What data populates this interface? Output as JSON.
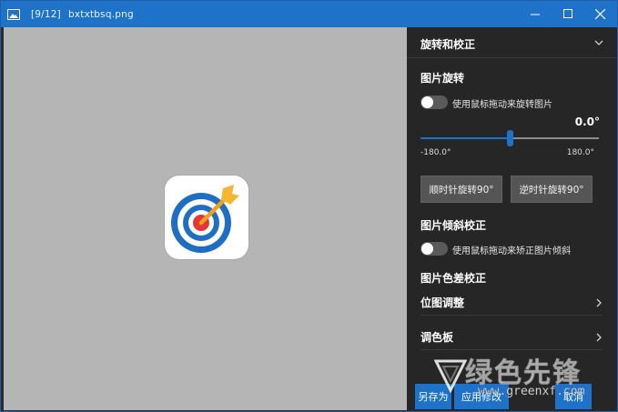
{
  "window": {
    "counter": "[9/12]",
    "filename": "bxtxtbsq.png"
  },
  "panel": {
    "header": "旋转和校正",
    "rotate": {
      "title": "图片旋转",
      "toggle_label": "使用鼠标拖动来旋转图片",
      "angle": "0.0°",
      "angle_value": 0.0,
      "min_label": "-180.0°",
      "max_label": "180.0°",
      "cw_button": "顺时针旋转90°",
      "ccw_button": "逆时针旋转90°"
    },
    "skew": {
      "title": "图片倾斜校正",
      "toggle_label": "使用鼠标拖动来矫正图片倾斜"
    },
    "color": {
      "title": "图片色差校正"
    },
    "rows": [
      {
        "label": "位图调整"
      },
      {
        "label": "调色板"
      }
    ],
    "footer": {
      "save_as": "另存为",
      "apply": "应用修改",
      "cancel": "取消"
    }
  },
  "colors": {
    "accent": "#1e73c8",
    "canvas_bg": "#b5b5b5",
    "panel_bg": "#262626"
  }
}
